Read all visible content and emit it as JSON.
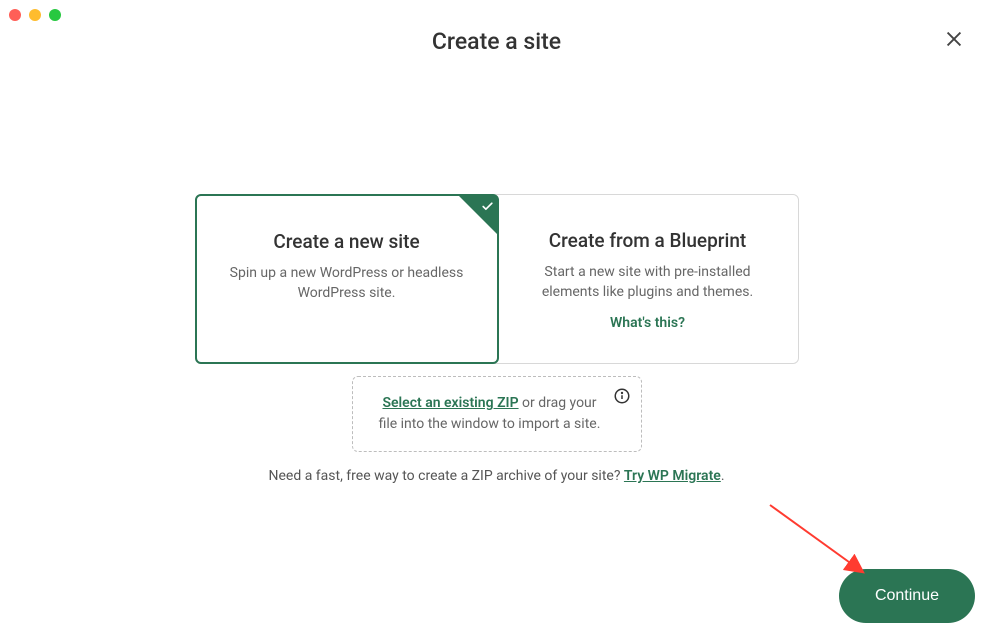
{
  "header": {
    "title": "Create a site"
  },
  "options": {
    "new_site": {
      "title": "Create a new site",
      "description": "Spin up a new WordPress or headless WordPress site."
    },
    "blueprint": {
      "title": "Create from a Blueprint",
      "description": "Start a new site with pre-installed elements like plugins and themes.",
      "whats_this": "What's this?"
    }
  },
  "drop_zone": {
    "select_link": "Select an existing ZIP",
    "suffix": " or drag your file into the window to import a site."
  },
  "hint": {
    "prefix": "Need a fast, free way to create a ZIP archive of your site? ",
    "link": "Try WP Migrate",
    "suffix": "."
  },
  "actions": {
    "continue": "Continue"
  },
  "colors": {
    "accent": "#2b7554"
  }
}
